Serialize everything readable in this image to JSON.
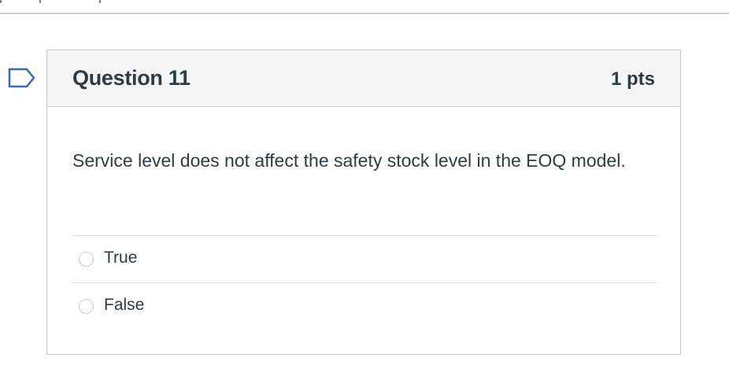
{
  "question": {
    "title": "Question 11",
    "points": "1 pts",
    "text": "Service level does not affect the safety stock level in the EOQ model.",
    "answers": [
      {
        "label": "True",
        "selected": false
      },
      {
        "label": "False",
        "selected": false
      }
    ]
  },
  "icons": {
    "flag": "flag-question-icon"
  },
  "colors": {
    "text": "#2d3b45",
    "header_bg": "#f5f5f5",
    "border": "#c7cdd1",
    "flag": "#2d6cc0"
  }
}
